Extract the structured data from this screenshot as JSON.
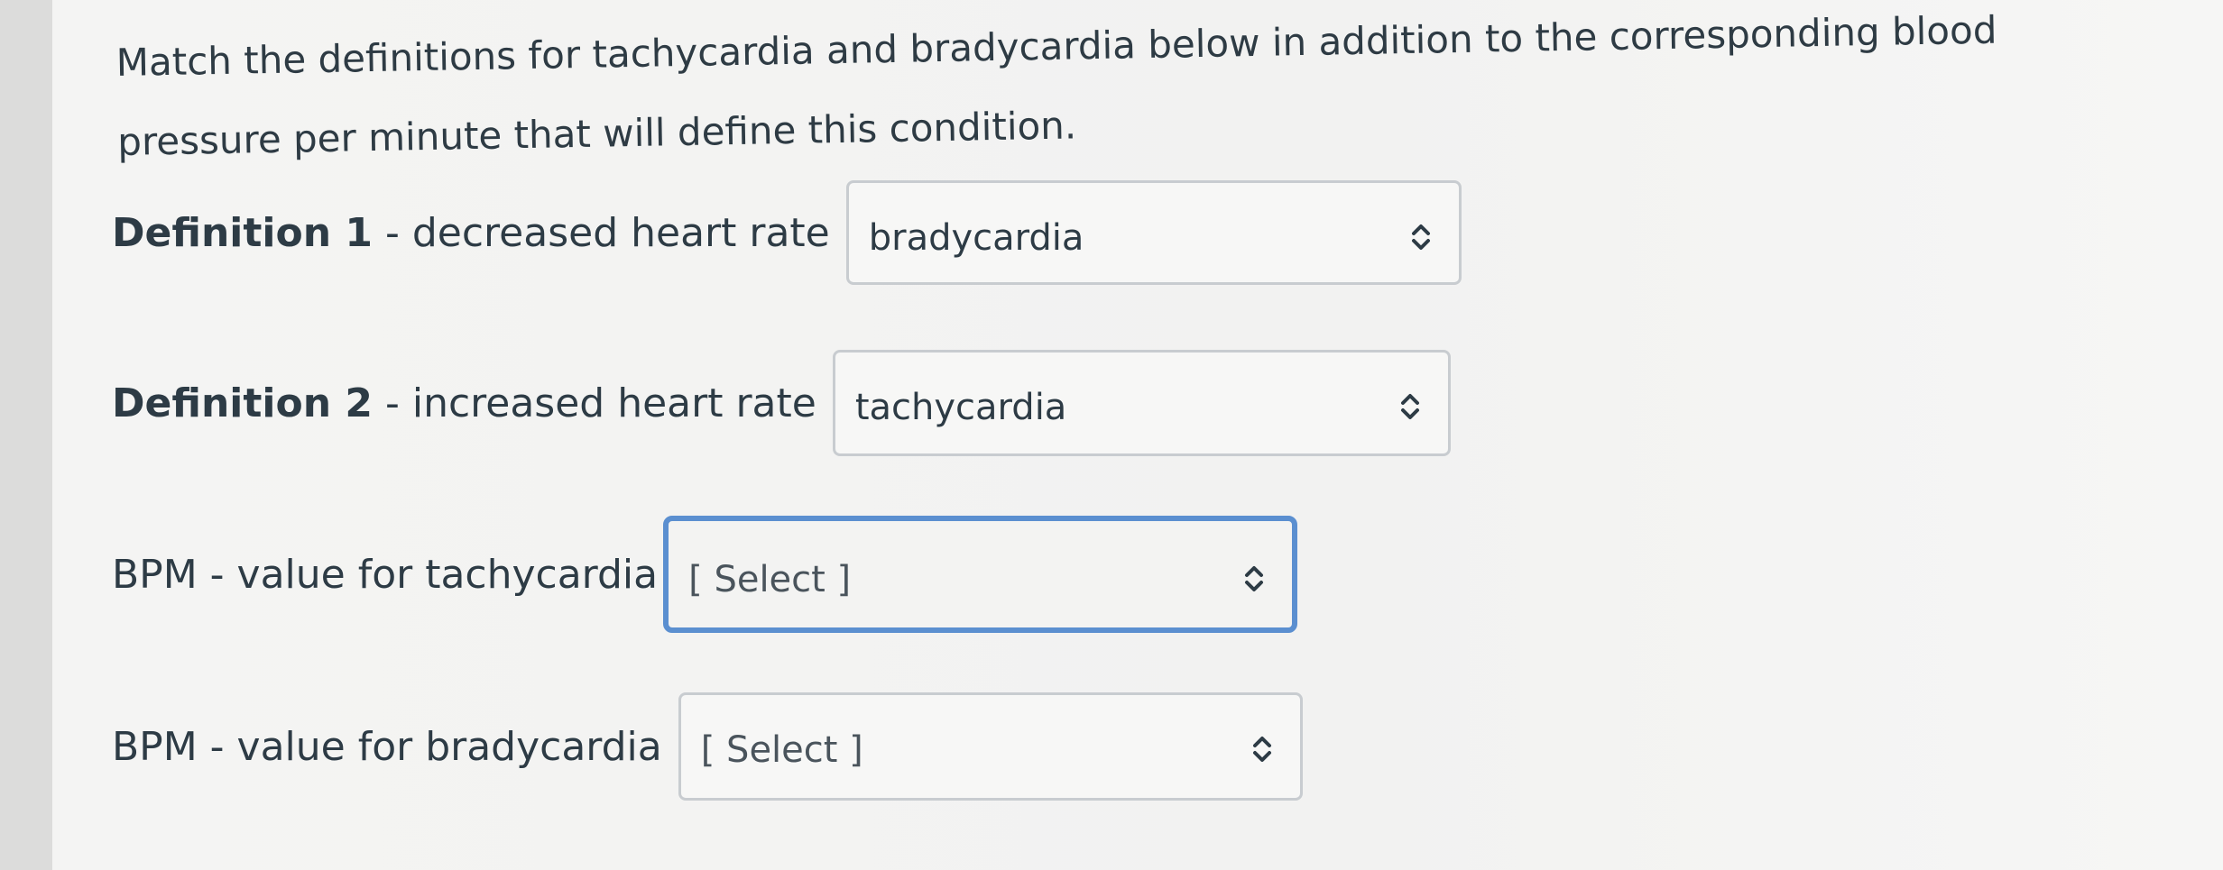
{
  "question": {
    "prompt_line1": "Match the definitions for tachycardia and bradycardia below in addition to the corresponding blood",
    "prompt_line2": "pressure per minute that will define this condition."
  },
  "rows": [
    {
      "label_bold": "Definition 1",
      "label_rest": " - decreased heart rate",
      "selected": "bradycardia"
    },
    {
      "label_bold": "Definition 2",
      "label_rest": " - increased heart rate",
      "selected": "tachycardia"
    },
    {
      "label_bold": "BPM",
      "label_rest": " - value for tachycardia",
      "selected": "[ Select ]"
    },
    {
      "label_bold": "BPM",
      "label_rest": " - value for bradycardia",
      "selected": "[ Select ]"
    }
  ],
  "icons": {
    "select_chevron": "chevron-up-down-icon"
  },
  "colors": {
    "focus_border": "#5b8fd0",
    "text": "#2d3b45"
  }
}
